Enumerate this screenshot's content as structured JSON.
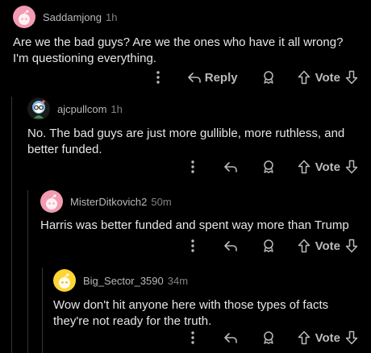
{
  "colors": {
    "background": "#000000",
    "text": "#e4e6e8",
    "muted": "#818384",
    "thread_line": "#343536",
    "avatar_pink": "#f39bb0",
    "avatar_yellow": "#ffd635"
  },
  "comments": [
    {
      "username": "Saddamjong",
      "age": "1h",
      "body": "Are we the bad guys? Are we the ones who have it all wrong? I'm questioning everything.",
      "reply_label": "Reply",
      "vote_label": "Vote",
      "avatar_icon": "snoo-pink-avatar-icon"
    },
    {
      "username": "ajcpullcom",
      "age": "1h",
      "body": "No. The bad guys are just more gullible, more ruthless, and better funded.",
      "vote_label": "Vote",
      "avatar_icon": "snoo-glasses-avatar-icon"
    },
    {
      "username": "MisterDitkovich2",
      "age": "50m",
      "body": "Harris was better funded and spent way more than Trump",
      "vote_label": "Vote",
      "avatar_icon": "snoo-pink-avatar-icon"
    },
    {
      "username": "Big_Sector_3590",
      "age": "34m",
      "body": "Wow don't hit anyone here with those types of facts they're not ready for the truth.",
      "vote_label": "Vote",
      "avatar_icon": "snoo-yellow-avatar-icon"
    }
  ]
}
